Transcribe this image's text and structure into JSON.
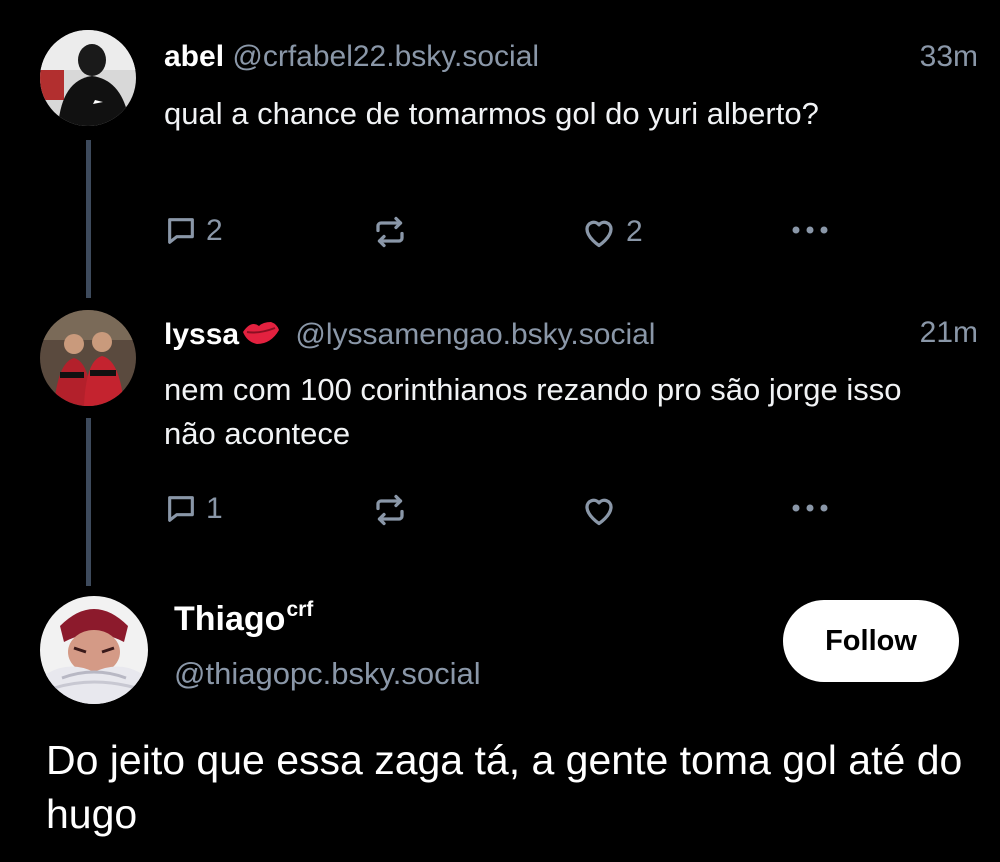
{
  "posts": [
    {
      "display_name": "abel",
      "handle": "@crfabel22.bsky.social",
      "time": "33m",
      "text": "qual a chance de tomarmos gol do yuri alberto?",
      "replies": "2",
      "reposts": "",
      "likes": "2"
    },
    {
      "display_name": "lyssa",
      "name_emoji": "💋",
      "handle": "@lyssamengao.bsky.social",
      "time": "21m",
      "text": "nem com 100 corinthianos rezando pro são jorge isso não acontece",
      "replies": "1",
      "reposts": "",
      "likes": ""
    }
  ],
  "main_post": {
    "display_name": "Thiago",
    "name_superscript": "crf",
    "handle": "@thiagopc.bsky.social",
    "follow_label": "Follow",
    "text": "Do jeito que essa zaga tá, a gente toma gol até do hugo"
  },
  "colors": {
    "background": "#000000",
    "muted_text": "#8a97a8",
    "thread_line": "#3d4a5c",
    "lips_emoji": "#e3213f"
  },
  "icons": [
    "reply-icon",
    "repost-icon",
    "like-icon",
    "more-icon"
  ]
}
